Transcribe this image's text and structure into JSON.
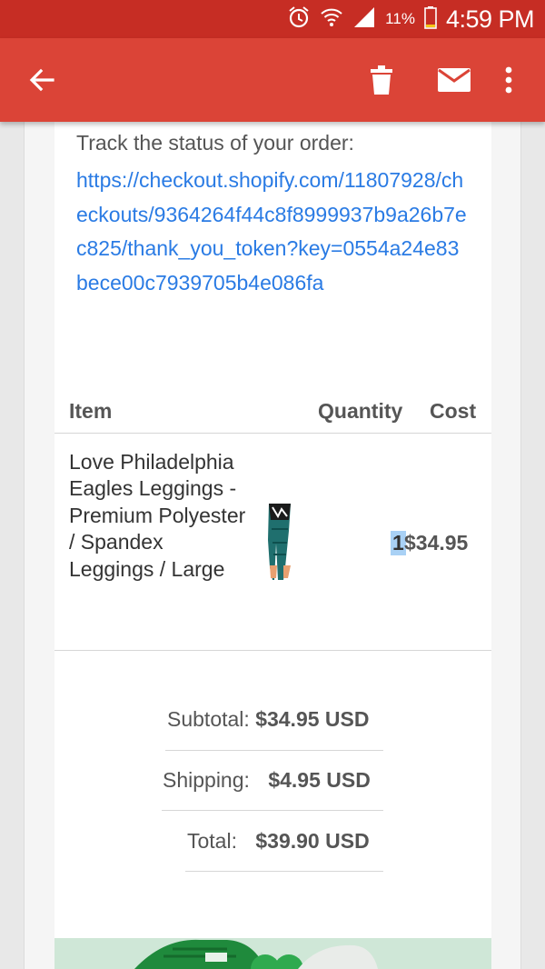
{
  "status_bar": {
    "battery_pct": "11%",
    "time": "4:59 PM"
  },
  "app_bar": {
    "back_icon": "arrow-back-icon",
    "delete_icon": "trash-icon",
    "mail_icon": "mail-icon",
    "more_icon": "more-vert-icon",
    "color": "#db4437"
  },
  "email": {
    "track_label": "Track the status of your order:",
    "track_url": "https://checkout.shopify.com/11807928/checkouts/9364264f44c8f8999937b9a26b7ec825/thank_you_token?key=0554a24e83bece00c7939705b4e086fa",
    "table": {
      "headers": {
        "item": "Item",
        "quantity": "Quantity",
        "cost": "Cost"
      },
      "rows": [
        {
          "name": "Love Philadelphia Eagles Leggings - Premium Polyester / Spandex Leggings / Large",
          "quantity": "1",
          "cost": "$34.95"
        }
      ]
    },
    "summary": {
      "subtotal_label": "Subtotal:",
      "subtotal_value": "$34.95 USD",
      "shipping_label": "Shipping:",
      "shipping_value": "$4.95 USD",
      "total_label": "Total:",
      "total_value": "$39.90 USD"
    }
  }
}
